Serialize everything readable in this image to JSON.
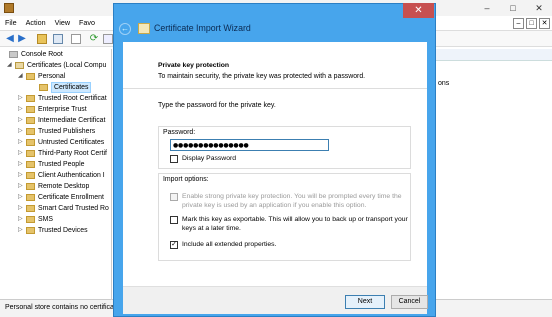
{
  "mmc": {
    "menu": [
      "File",
      "Action",
      "View",
      "Favo"
    ],
    "tree": [
      {
        "label": "Console Root",
        "level": 0,
        "arrow": "",
        "icon": "root"
      },
      {
        "label": "Certificates (Local Compu",
        "level": 1,
        "arrow": "◢",
        "icon": "cert"
      },
      {
        "label": "Personal",
        "level": 2,
        "arrow": "◢",
        "icon": "folder"
      },
      {
        "label": "Certificates",
        "level": 3,
        "arrow": "",
        "icon": "folder",
        "selected": true
      },
      {
        "label": "Trusted Root Certificat",
        "level": 2,
        "arrow": "▷",
        "icon": "folder"
      },
      {
        "label": "Enterprise Trust",
        "level": 2,
        "arrow": "▷",
        "icon": "folder"
      },
      {
        "label": "Intermediate Certificat",
        "level": 2,
        "arrow": "▷",
        "icon": "folder"
      },
      {
        "label": "Trusted Publishers",
        "level": 2,
        "arrow": "▷",
        "icon": "folder"
      },
      {
        "label": "Untrusted Certificates",
        "level": 2,
        "arrow": "▷",
        "icon": "folder"
      },
      {
        "label": "Third-Party Root Certif",
        "level": 2,
        "arrow": "▷",
        "icon": "folder"
      },
      {
        "label": "Trusted People",
        "level": 2,
        "arrow": "▷",
        "icon": "folder"
      },
      {
        "label": "Client Authentication I",
        "level": 2,
        "arrow": "▷",
        "icon": "folder"
      },
      {
        "label": "Remote Desktop",
        "level": 2,
        "arrow": "▷",
        "icon": "folder"
      },
      {
        "label": "Certificate Enrollment",
        "level": 2,
        "arrow": "▷",
        "icon": "folder"
      },
      {
        "label": "Smart Card Trusted Ro",
        "level": 2,
        "arrow": "▷",
        "icon": "folder"
      },
      {
        "label": "SMS",
        "level": 2,
        "arrow": "▷",
        "icon": "folder"
      },
      {
        "label": "Trusted Devices",
        "level": 2,
        "arrow": "▷",
        "icon": "folder"
      }
    ],
    "right_pane_item": "ons",
    "status": "Personal store contains no certifica",
    "window_buttons": [
      "–",
      "□",
      "✕"
    ]
  },
  "wizard": {
    "title": "Certificate Import Wizard",
    "section_title": "Private key protection",
    "section_subtitle": "To maintain security, the private key was protected with a password.",
    "type_password_prompt": "Type the password for the private key.",
    "password_label": "Password:",
    "password_value": "●●●●●●●●●●●●●●●",
    "display_password_label": "Display Password",
    "import_options_label": "Import options:",
    "options": [
      {
        "text_line1": "Enable strong private key protection. You will be prompted every time the",
        "text_line2": "private key is used by an application if you enable this option.",
        "checked": false,
        "disabled": true
      },
      {
        "text_line1": "Mark this key as exportable. This will allow you to back up or transport your",
        "text_line2": "keys at a later time.",
        "checked": false,
        "disabled": false
      },
      {
        "text_line1": "Include all extended properties.",
        "text_line2": "",
        "checked": true,
        "disabled": false
      }
    ],
    "next_label": "Next",
    "cancel_label": "Cancel"
  }
}
